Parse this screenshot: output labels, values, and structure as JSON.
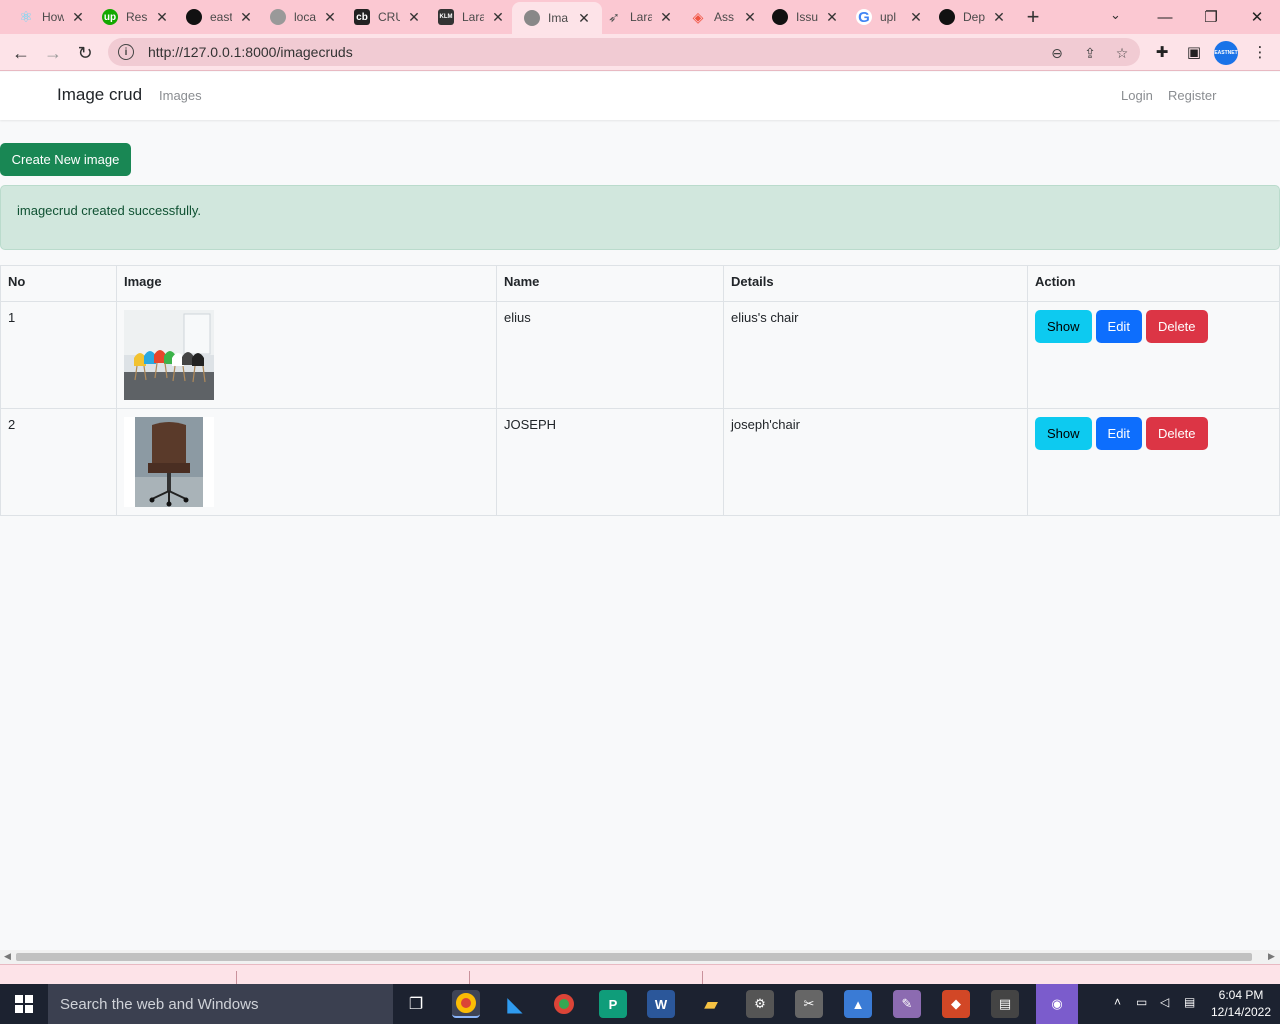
{
  "browser": {
    "tabs": [
      {
        "label": "How",
        "icon": "react-icon",
        "color": "#61dafb"
      },
      {
        "label": "Res",
        "icon": "upwork-icon",
        "color": "#14a800"
      },
      {
        "label": "east",
        "icon": "github-icon",
        "color": "#111111"
      },
      {
        "label": "loca",
        "icon": "globe-icon",
        "color": "#888888"
      },
      {
        "label": "CRU",
        "icon": "laracasts-icon",
        "color": "#222222"
      },
      {
        "label": "Lara",
        "icon": "klm-icon",
        "color": "#333333"
      },
      {
        "label": "Ima",
        "icon": "globe-icon",
        "color": "#777777",
        "active": true
      },
      {
        "label": "Lara",
        "icon": "paper-plane-icon",
        "color": "#555555"
      },
      {
        "label": "Ass",
        "icon": "laravel-icon",
        "color": "#f05340"
      },
      {
        "label": "Issu",
        "icon": "github-icon",
        "color": "#111111"
      },
      {
        "label": "upl",
        "icon": "google-icon",
        "color": "#4285f4"
      },
      {
        "label": "Dep",
        "icon": "github-icon",
        "color": "#111111"
      }
    ],
    "url": "http://127.0.0.1:8000/imagecruds",
    "profile_label": "EASTNET"
  },
  "navbar": {
    "brand": "Image crud",
    "links": [
      "Images"
    ],
    "right_links": [
      "Login",
      "Register"
    ]
  },
  "main": {
    "create_button": "Create New image",
    "alert": "imagecrud created successfully.",
    "table": {
      "headers": [
        "No",
        "Image",
        "Name",
        "Details",
        "Action"
      ],
      "rows": [
        {
          "no": "1",
          "name": "elius",
          "details": "elius's chair"
        },
        {
          "no": "2",
          "name": "JOSEPH",
          "details": "joseph'chair"
        }
      ],
      "actions": {
        "show": "Show",
        "edit": "Edit",
        "delete": "Delete"
      }
    }
  },
  "taskbar": {
    "search_placeholder": "Search the web and Windows",
    "time": "6:04 PM",
    "date": "12/14/2022"
  },
  "colors": {
    "success": "#198754",
    "info": "#0dcaf0",
    "primary": "#0d6efd",
    "danger": "#dc3545",
    "alert_bg": "#d1e7dd",
    "chrome_pink": "#fbc8d2"
  }
}
